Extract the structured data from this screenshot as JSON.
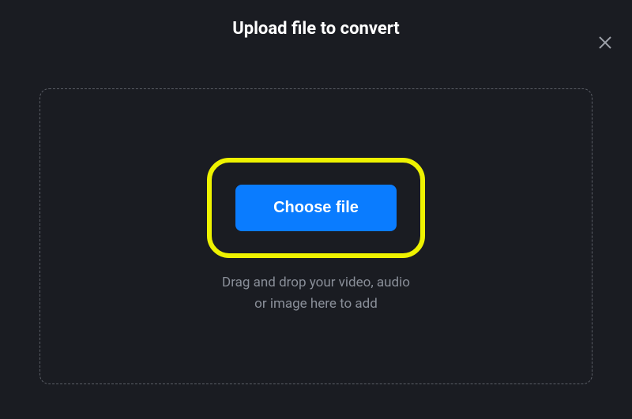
{
  "header": {
    "title": "Upload file to convert"
  },
  "actions": {
    "close": "close"
  },
  "dropzone": {
    "button_label": "Choose file",
    "hint_line1": "Drag and drop your video, audio",
    "hint_line2": "or image here to add"
  },
  "colors": {
    "background": "#1a1c22",
    "accent": "#0a7cff",
    "highlight": "#eef200"
  }
}
